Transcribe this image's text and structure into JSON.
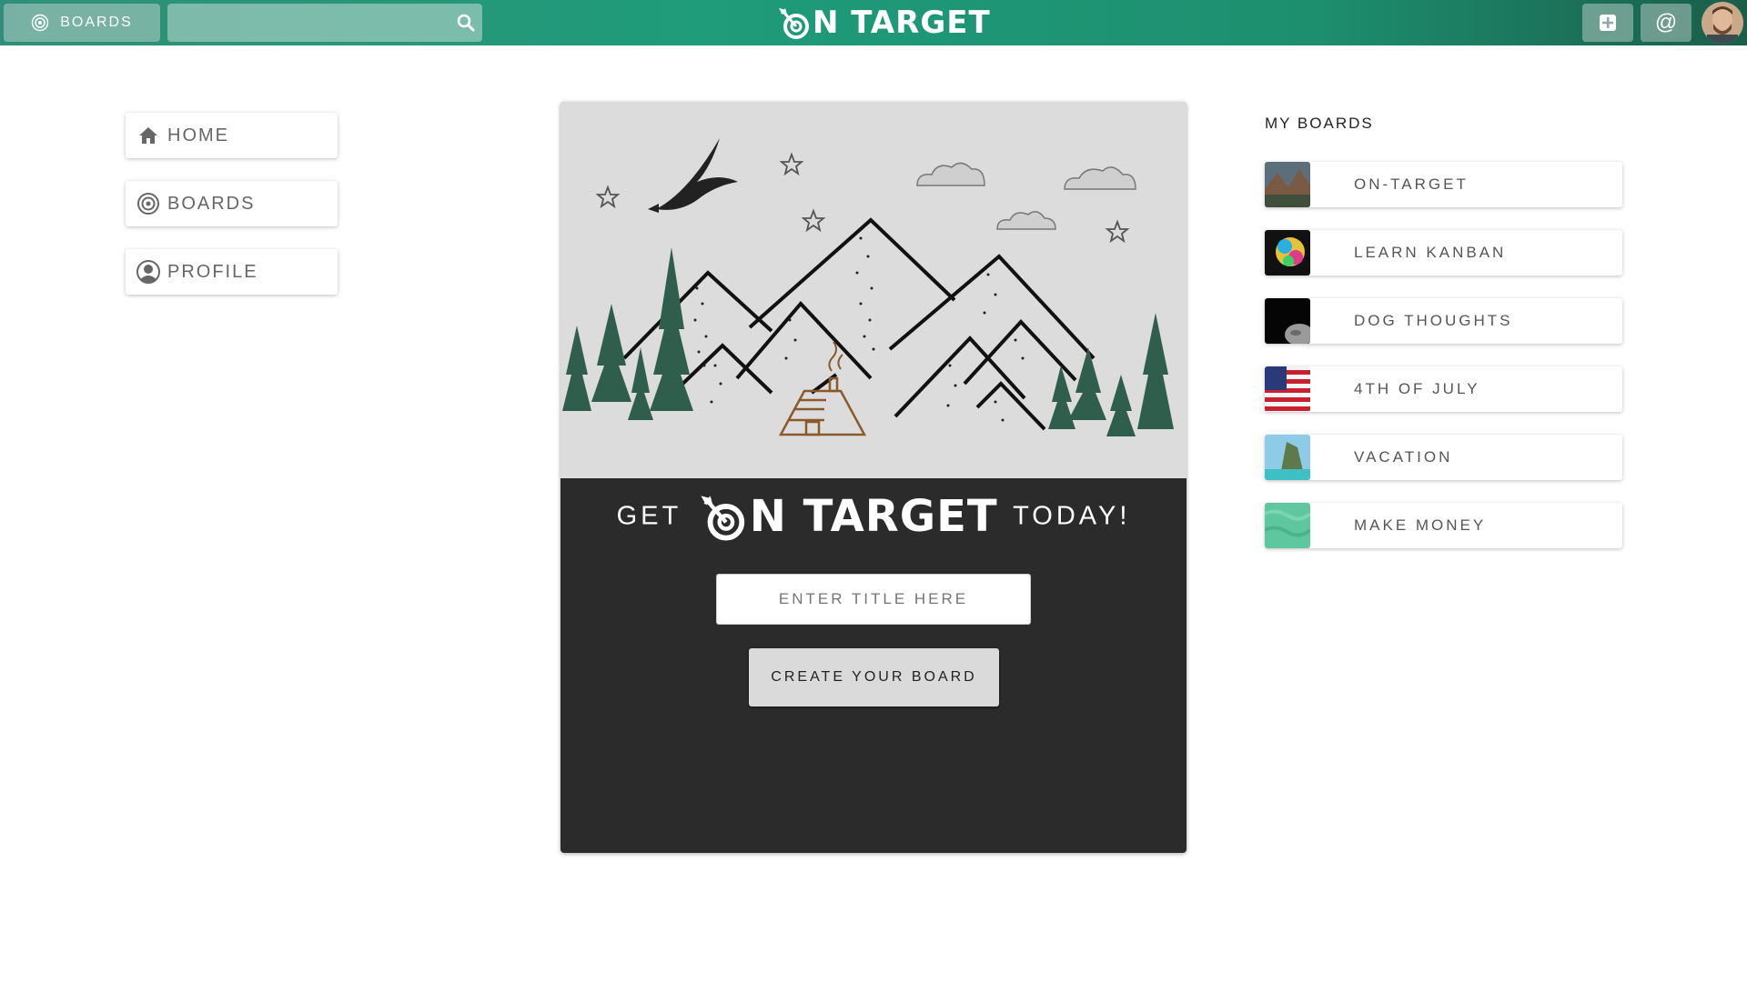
{
  "topbar": {
    "boards_label": "BOARDS",
    "search_placeholder": "",
    "logo_text": "N TARGET",
    "add_icon": "plus-square-icon",
    "at_label": "@"
  },
  "nav": {
    "items": [
      {
        "label": "HOME",
        "icon": "home-icon"
      },
      {
        "label": "BOARDS",
        "icon": "target-icon"
      },
      {
        "label": "PROFILE",
        "icon": "user-circle-icon"
      }
    ]
  },
  "hero": {
    "get": "GET",
    "logo_text": "N TARGET",
    "today": "TODAY!",
    "title_placeholder": "ENTER TITLE HERE",
    "create_label": "CREATE YOUR BOARD"
  },
  "my_boards": {
    "title": "MY BOARDS",
    "items": [
      {
        "label": "ON-TARGET",
        "thumb": "landscape"
      },
      {
        "label": "LEARN KANBAN",
        "thumb": "lion"
      },
      {
        "label": "DOG THOUGHTS",
        "thumb": "moon"
      },
      {
        "label": "4TH OF JULY",
        "thumb": "flag"
      },
      {
        "label": "VACATION",
        "thumb": "beach"
      },
      {
        "label": "MAKE MONEY",
        "thumb": "green-texture"
      }
    ]
  },
  "colors": {
    "brand": "#1f9c7a",
    "card_dark": "#2b2b2b",
    "illustration_bg": "#dcdcdc"
  }
}
